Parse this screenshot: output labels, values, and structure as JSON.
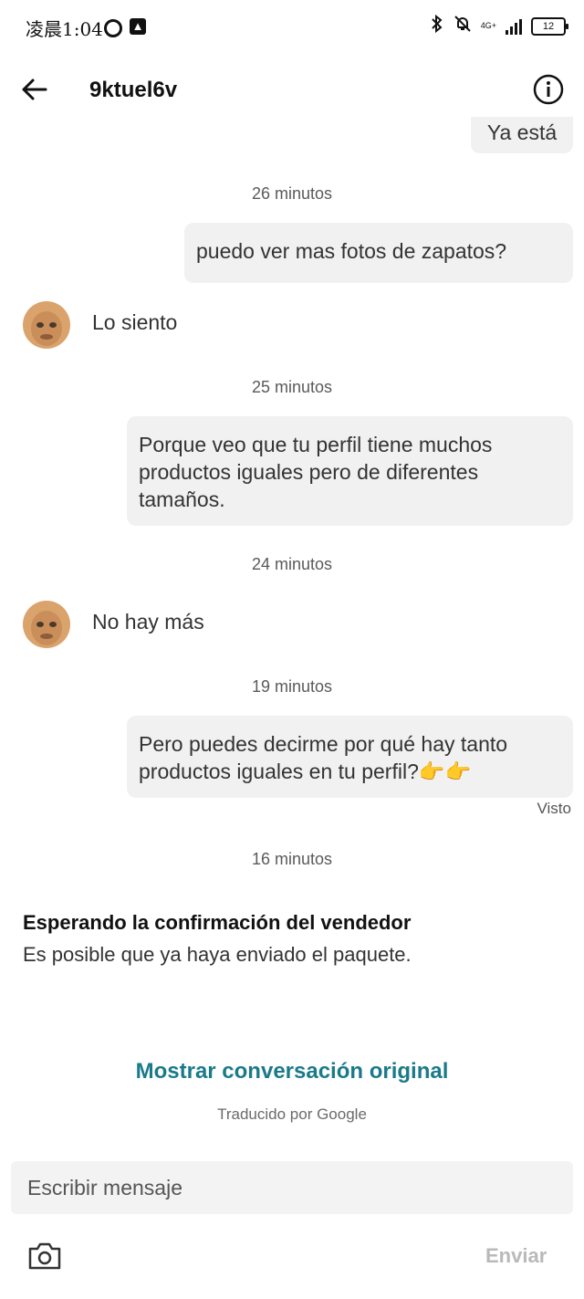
{
  "status_bar": {
    "time": "凌晨1:04",
    "network": "4G+",
    "battery": "12",
    "icons": [
      "circle-icon",
      "upload-icon",
      "bluetooth-icon",
      "mute-bell-icon",
      "signal-icon",
      "battery-icon"
    ]
  },
  "header": {
    "title": "9ktuel6v",
    "back_icon": "back-arrow-icon",
    "info_icon": "info-icon"
  },
  "messages": {
    "partial_top": "Ya está",
    "ts1": "26 minutos",
    "m1": "puedo ver mas fotos de zapatos?",
    "m2": "Lo siento",
    "ts2": "25 minutos",
    "m3": "Porque veo que tu perfil tiene muchos productos iguales pero de diferentes tamaños.",
    "ts3": "24 minutos",
    "m4": "No hay más",
    "ts4": "19 minutos",
    "m5": "Pero puedes decirme por qué hay tanto productos iguales en tu perfil?👉👉",
    "seen": "Visto",
    "ts5": "16 minutos"
  },
  "notice": {
    "title": "Esperando la confirmación del vendedor",
    "subtitle": "Es posible que ya haya enviado el paquete."
  },
  "translation": {
    "show_original": "Mostrar conversación original",
    "translated_by": "Traducido por Google"
  },
  "composer": {
    "placeholder": "Escribir mensaje",
    "send_label": "Enviar",
    "camera_icon": "camera-icon"
  },
  "colors": {
    "accent": "#1b7a8a",
    "bubble": "#f1f1f1",
    "send_disabled": "#b9b9b9"
  }
}
